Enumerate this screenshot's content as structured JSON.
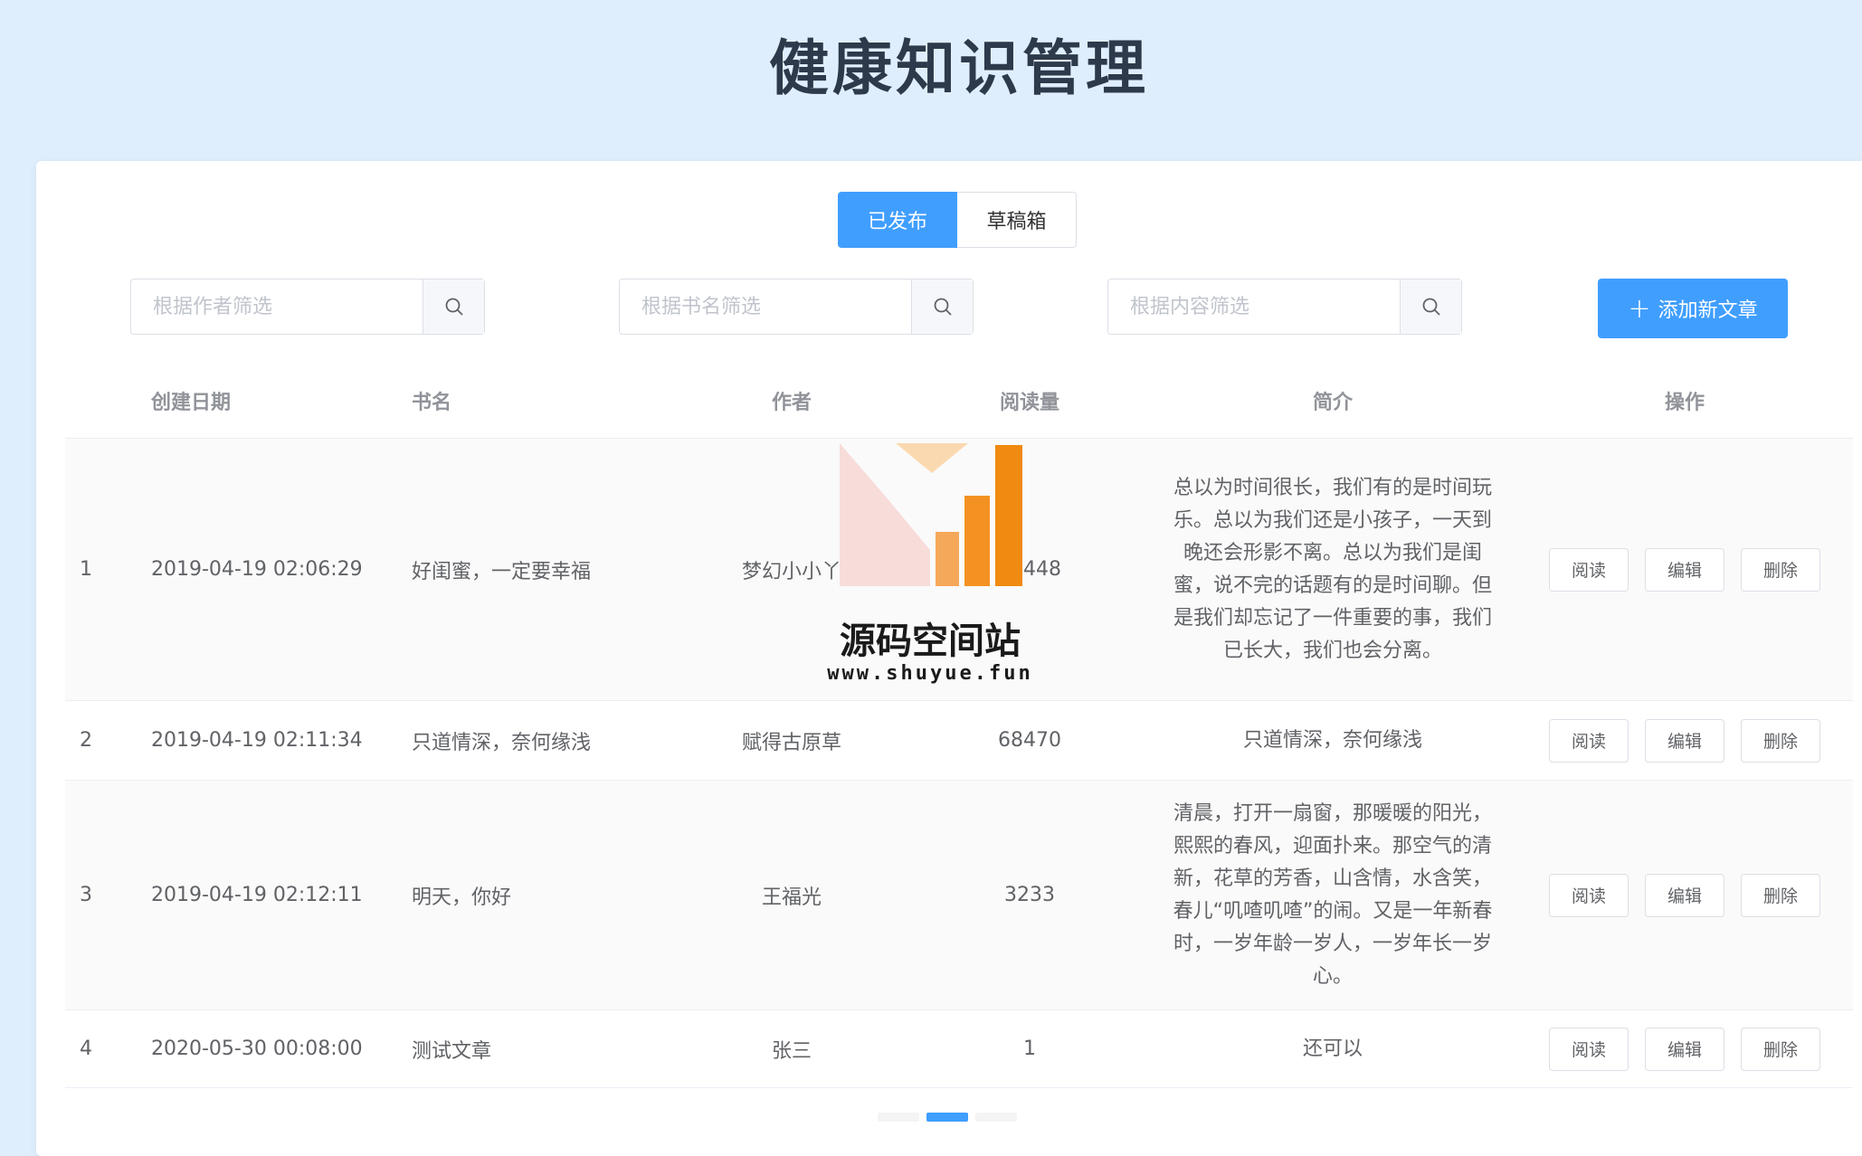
{
  "page": {
    "title": "健康知识管理"
  },
  "tabs": [
    {
      "label": "已发布",
      "active": true
    },
    {
      "label": "草稿箱",
      "active": false
    }
  ],
  "filters": {
    "author_placeholder": "根据作者筛选",
    "book_placeholder": "根据书名筛选",
    "content_placeholder": "根据内容筛选"
  },
  "add_button": {
    "label": "添加新文章"
  },
  "table": {
    "headers": [
      "创建日期",
      "书名",
      "作者",
      "阅读量",
      "简介",
      "操作"
    ],
    "rows": [
      {
        "index": "1",
        "date": "2019-04-19 02:06:29",
        "title": "好闺蜜，一定要幸福",
        "author": "梦幻小小丫",
        "reads": "39448",
        "intro": "总以为时间很长，我们有的是时间玩乐。总以为我们还是小孩子，一天到晚还会形影不离。总以为我们是闺蜜，说不完的话题有的是时间聊。但是我们却忘记了一件重要的事，我们已长大，我们也会分离。"
      },
      {
        "index": "2",
        "date": "2019-04-19 02:11:34",
        "title": "只道情深，奈何缘浅",
        "author": "赋得古原草",
        "reads": "68470",
        "intro": "只道情深，奈何缘浅"
      },
      {
        "index": "3",
        "date": "2019-04-19 02:12:11",
        "title": "明天，你好",
        "author": "王福光",
        "reads": "3233",
        "intro": "清晨，打开一扇窗，那暖暖的阳光，熙熙的春风，迎面扑来。那空气的清新，花草的芳香，山含情，水含笑，春儿“叽喳叽喳”的闹。又是一年新春时，一岁年龄一岁人，一岁年长一岁心。"
      },
      {
        "index": "4",
        "date": "2020-05-30 00:08:00",
        "title": "测试文章",
        "author": "张三",
        "reads": "1",
        "intro": "还可以"
      }
    ],
    "actions": {
      "read": "阅读",
      "edit": "编辑",
      "delete": "删除"
    }
  },
  "watermark": {
    "name": "源码空间站",
    "url": "www.shuyue.fun"
  },
  "colors": {
    "primary": "#409eff",
    "background": "#dfeefc",
    "watermark_orange": "#f39222"
  }
}
